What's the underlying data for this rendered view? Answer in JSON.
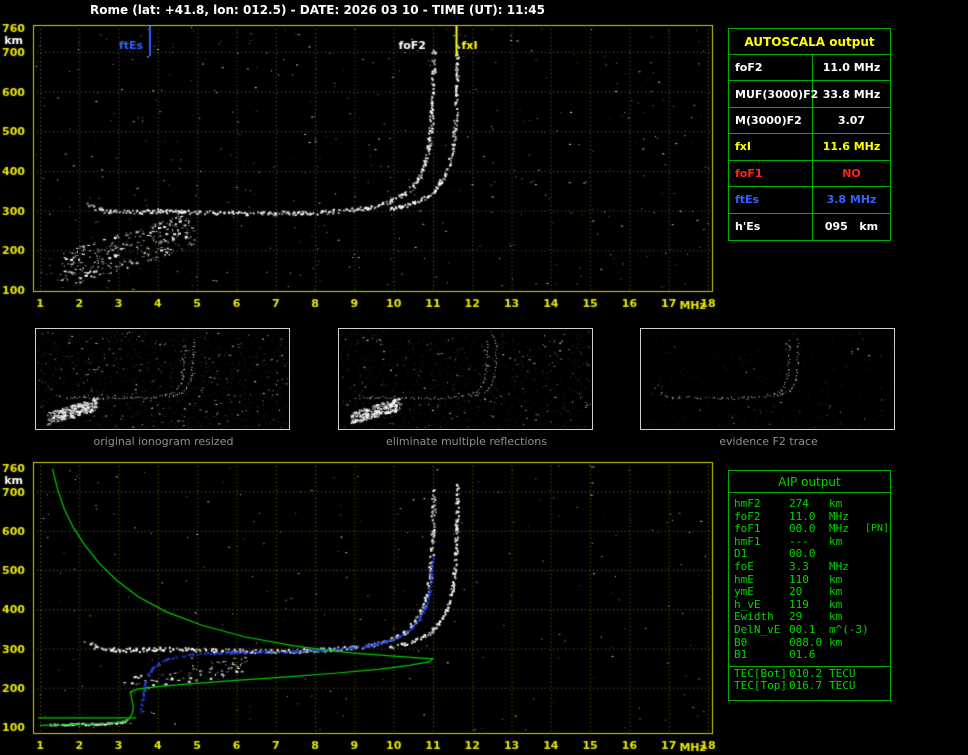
{
  "colors": {
    "background": "#000000",
    "plot_border": "#d2d200",
    "axis_ticks": "#e8e800",
    "grid": "#6d6d00",
    "table_border": "#00b000",
    "green_text": "#00d800",
    "yellow": "#ffff00",
    "red": "#ff2222",
    "blue": "#2f63ff",
    "white": "#ffffff",
    "caption_gray": "#8f8f8f",
    "profile_green": "#00cc00",
    "trace_blue": "#2244ee"
  },
  "header": {
    "title": "Rome (lat: +41.8, lon: 012.5) - DATE: 2026 03 10 - TIME (UT): 11:45"
  },
  "autoscala": {
    "title": "AUTOSCALA output",
    "rows": [
      {
        "label": "foF2",
        "value": "11.0 MHz",
        "color": "white"
      },
      {
        "label": "MUF(3000)F2",
        "value": "33.8 MHz",
        "color": "white"
      },
      {
        "label": "M(3000)F2",
        "value": "3.07",
        "color": "white"
      },
      {
        "label": "fxI",
        "value": "11.6 MHz",
        "color": "yellow"
      },
      {
        "label": "foF1",
        "value": "NO",
        "color": "red"
      },
      {
        "label": "ftEs",
        "value": "3.8 MHz",
        "color": "blue"
      },
      {
        "label": "h'Es",
        "value": "095   km",
        "color": "white"
      }
    ]
  },
  "aip": {
    "title": "AIP output",
    "rows": [
      {
        "name": "hmF2",
        "value": "274",
        "unit": "km",
        "note": ""
      },
      {
        "name": "foF2",
        "value": "11.0",
        "unit": "MHz",
        "note": ""
      },
      {
        "name": "foF1",
        "value": "00.0",
        "unit": "MHz",
        "note": "[PN]"
      },
      {
        "name": "hmF1",
        "value": "---",
        "unit": "km",
        "note": ""
      },
      {
        "name": "D1",
        "value": "00.0",
        "unit": "",
        "note": ""
      },
      {
        "name": "foE",
        "value": "3.3",
        "unit": "MHz",
        "note": ""
      },
      {
        "name": "hmE",
        "value": "110",
        "unit": "km",
        "note": ""
      },
      {
        "name": "ymE",
        "value": "20",
        "unit": "km",
        "note": ""
      },
      {
        "name": "h_vE",
        "value": "119",
        "unit": "km",
        "note": ""
      },
      {
        "name": "Ewidth",
        "value": "29",
        "unit": "km",
        "note": ""
      },
      {
        "name": "DelN_vE",
        "value": "00.1",
        "unit": "m^(-3)",
        "note": ""
      },
      {
        "name": "B0",
        "value": "088.0",
        "unit": "km",
        "note": ""
      },
      {
        "name": "B1",
        "value": "01.6",
        "unit": "",
        "note": ""
      },
      {
        "name": "TEC[Bot]",
        "value": "010.2",
        "unit": "TECU",
        "note": ""
      },
      {
        "name": "TEC[Top]",
        "value": "016.7",
        "unit": "TECU",
        "note": ""
      }
    ]
  },
  "thumbnails": [
    {
      "caption": "original ionogram resized",
      "noise_count": 260,
      "gray_count": 1000,
      "show_spread": true
    },
    {
      "caption": "eliminate multiple reflections",
      "noise_count": 190,
      "gray_count": 800,
      "show_spread": true
    },
    {
      "caption": "evidence F2 trace",
      "noise_count": 45,
      "gray_count": 260,
      "show_spread": false
    }
  ],
  "chart_data": [
    {
      "id": "top_ionogram",
      "type": "scatter",
      "xlabel": "MHz",
      "ylabel": "km",
      "xlim": [
        1,
        18
      ],
      "ylim": [
        100,
        760
      ],
      "xticks": [
        1,
        2,
        3,
        4,
        5,
        6,
        7,
        8,
        9,
        10,
        11,
        12,
        13,
        14,
        15,
        16,
        17,
        18
      ],
      "yticks": [
        100,
        200,
        300,
        400,
        500,
        600,
        700,
        760
      ],
      "grid": true,
      "noise_count": 420,
      "markers": [
        {
          "label": "ftEs",
          "freq": 3.8,
          "color": "#2f63ff",
          "side": "left",
          "lw": 2
        },
        {
          "label": "foF2",
          "freq": 11.0,
          "color": "#ffffff",
          "side": "left",
          "lw": 0
        },
        {
          "label": "fxI",
          "freq": 11.6,
          "color": "#ffff00",
          "side": "right",
          "lw": 2
        }
      ],
      "series": [
        {
          "name": "F2 ordinary trace",
          "color": "#ffffff",
          "spread": 2,
          "points": [
            [
              2.15,
              318
            ],
            [
              2.4,
              306
            ],
            [
              2.8,
              299
            ],
            [
              3.4,
              298
            ],
            [
              4.0,
              301
            ],
            [
              4.6,
              299
            ],
            [
              5.4,
              297
            ],
            [
              6.2,
              295
            ],
            [
              7.0,
              295
            ],
            [
              7.8,
              296
            ],
            [
              8.4,
              299
            ],
            [
              8.9,
              303
            ],
            [
              9.3,
              309
            ],
            [
              9.7,
              318
            ],
            [
              10.0,
              329
            ],
            [
              10.25,
              343
            ],
            [
              10.45,
              360
            ],
            [
              10.6,
              380
            ],
            [
              10.72,
              403
            ],
            [
              10.81,
              430
            ],
            [
              10.88,
              462
            ],
            [
              10.93,
              500
            ],
            [
              10.96,
              545
            ],
            [
              10.985,
              600
            ],
            [
              11.0,
              660
            ],
            [
              11.0,
              705
            ]
          ]
        },
        {
          "name": "F2 extraordinary trace",
          "color": "#ffffff",
          "spread": 1.6,
          "points": [
            [
              9.9,
              306
            ],
            [
              10.2,
              312
            ],
            [
              10.5,
              321
            ],
            [
              10.8,
              334
            ],
            [
              11.0,
              350
            ],
            [
              11.15,
              368
            ],
            [
              11.3,
              392
            ],
            [
              11.4,
              420
            ],
            [
              11.48,
              455
            ],
            [
              11.53,
              495
            ],
            [
              11.57,
              545
            ],
            [
              11.59,
              605
            ],
            [
              11.6,
              670
            ],
            [
              11.6,
              718
            ]
          ]
        },
        {
          "name": "spread echoes",
          "color": "#ffffff",
          "band": {
            "f": [
              1.5,
              4.9
            ],
            "h": [
              150,
              255
            ],
            "jitter": 45,
            "count": 300
          }
        }
      ]
    },
    {
      "id": "bottom_ionogram_with_profile",
      "type": "scatter",
      "xlabel": "MHz",
      "ylabel": "km",
      "xlim": [
        1,
        18
      ],
      "ylim": [
        100,
        760
      ],
      "xticks": [
        1,
        2,
        3,
        4,
        5,
        6,
        7,
        8,
        9,
        10,
        11,
        12,
        13,
        14,
        15,
        16,
        17,
        18
      ],
      "yticks": [
        100,
        200,
        300,
        400,
        500,
        600,
        700,
        760
      ],
      "grid": true,
      "noise_count": 230,
      "series": [
        {
          "name": "F2 ordinary trace",
          "color": "#ffffff",
          "spread": 2,
          "points": [
            [
              2.15,
              318
            ],
            [
              2.4,
              306
            ],
            [
              2.8,
              299
            ],
            [
              3.4,
              298
            ],
            [
              4.0,
              301
            ],
            [
              4.6,
              299
            ],
            [
              5.4,
              297
            ],
            [
              6.2,
              295
            ],
            [
              7.0,
              295
            ],
            [
              7.8,
              296
            ],
            [
              8.4,
              299
            ],
            [
              8.9,
              303
            ],
            [
              9.3,
              309
            ],
            [
              9.7,
              318
            ],
            [
              10.0,
              329
            ],
            [
              10.25,
              343
            ],
            [
              10.45,
              360
            ],
            [
              10.6,
              380
            ],
            [
              10.72,
              403
            ],
            [
              10.81,
              430
            ],
            [
              10.88,
              462
            ],
            [
              10.93,
              500
            ],
            [
              10.96,
              545
            ],
            [
              10.985,
              600
            ],
            [
              11.0,
              660
            ],
            [
              11.0,
              705
            ]
          ]
        },
        {
          "name": "F2 extraordinary trace",
          "color": "#ffffff",
          "spread": 1.6,
          "points": [
            [
              9.9,
              306
            ],
            [
              10.2,
              312
            ],
            [
              10.5,
              321
            ],
            [
              10.8,
              334
            ],
            [
              11.0,
              350
            ],
            [
              11.15,
              368
            ],
            [
              11.3,
              392
            ],
            [
              11.4,
              420
            ],
            [
              11.48,
              455
            ],
            [
              11.53,
              495
            ],
            [
              11.57,
              545
            ],
            [
              11.59,
              605
            ],
            [
              11.6,
              670
            ],
            [
              11.6,
              718
            ]
          ]
        },
        {
          "name": "E trace",
          "color": "#ffffff",
          "spread": 1,
          "points": [
            [
              1.25,
              108
            ],
            [
              1.8,
              108
            ],
            [
              2.3,
              109
            ],
            [
              2.8,
              111
            ],
            [
              3.05,
              114
            ],
            [
              3.2,
              118
            ]
          ]
        },
        {
          "name": "low echoes",
          "color": "#ffffff",
          "band": {
            "f": [
              3.1,
              6.2
            ],
            "h": [
              205,
              262
            ],
            "jitter": 22,
            "count": 90
          }
        },
        {
          "name": "restored trace",
          "color": "#2244ee",
          "spread": 1,
          "points": [
            [
              3.55,
              135
            ],
            [
              3.6,
              175
            ],
            [
              3.68,
              220
            ],
            [
              3.85,
              252
            ],
            [
              4.2,
              274
            ],
            [
              4.8,
              286
            ],
            [
              5.6,
              291
            ],
            [
              6.5,
              293
            ],
            [
              7.4,
              295
            ],
            [
              8.2,
              298
            ],
            [
              8.9,
              303
            ],
            [
              9.4,
              310
            ],
            [
              9.8,
              320
            ],
            [
              10.15,
              334
            ],
            [
              10.45,
              354
            ],
            [
              10.65,
              378
            ],
            [
              10.8,
              408
            ],
            [
              10.9,
              448
            ],
            [
              10.95,
              492
            ],
            [
              10.99,
              535
            ]
          ]
        },
        {
          "name": "electron density profile",
          "style": "line",
          "color": "#00cc00",
          "points": [
            [
              1.32,
              758
            ],
            [
              1.45,
              705
            ],
            [
              1.62,
              655
            ],
            [
              1.85,
              608
            ],
            [
              2.15,
              562
            ],
            [
              2.5,
              518
            ],
            [
              2.95,
              474
            ],
            [
              3.5,
              432
            ],
            [
              4.2,
              394
            ],
            [
              5.1,
              360
            ],
            [
              6.2,
              330
            ],
            [
              7.5,
              306
            ],
            [
              8.9,
              289
            ],
            [
              10.1,
              280
            ],
            [
              10.8,
              275
            ],
            [
              11.0,
              274
            ],
            [
              10.9,
              266
            ],
            [
              10.4,
              257
            ],
            [
              9.6,
              247
            ],
            [
              8.5,
              237
            ],
            [
              7.2,
              227
            ],
            [
              5.9,
              218
            ],
            [
              4.8,
              210
            ],
            [
              4.0,
              203
            ],
            [
              3.5,
              197
            ],
            [
              3.3,
              190
            ],
            [
              3.33,
              172
            ],
            [
              3.38,
              152
            ],
            [
              3.34,
              133
            ],
            [
              3.27,
              120
            ],
            [
              3.1,
              113
            ],
            [
              2.7,
              109
            ],
            [
              2.1,
              107
            ],
            [
              1.4,
              105
            ],
            [
              1.0,
              104
            ]
          ]
        },
        {
          "name": "valley line",
          "style": "line",
          "color": "#00cc00",
          "points": [
            [
              0.95,
              123
            ],
            [
              3.45,
              123
            ]
          ]
        }
      ]
    }
  ]
}
